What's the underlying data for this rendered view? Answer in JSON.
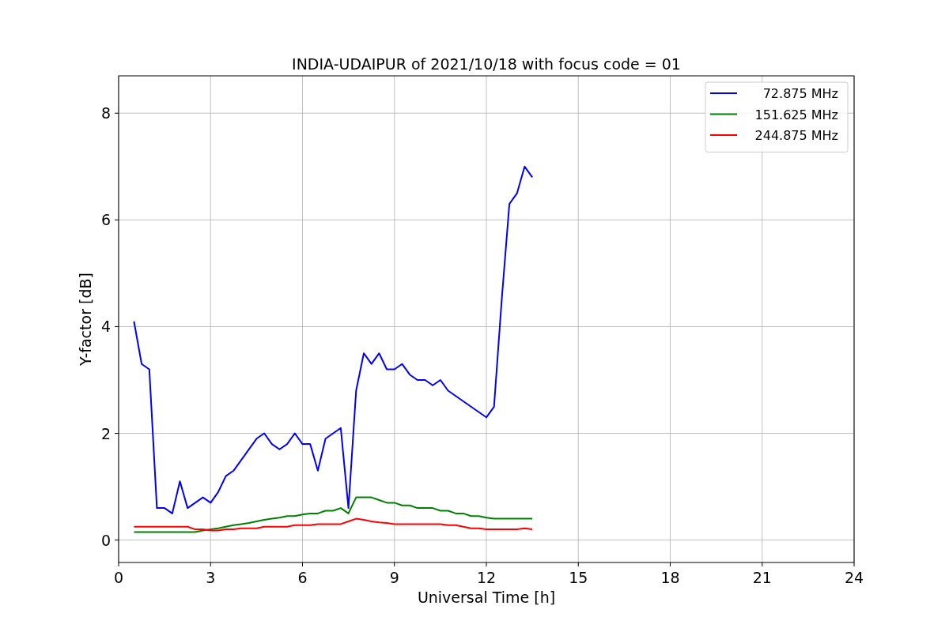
{
  "chart_data": {
    "type": "line",
    "title": "INDIA-UDAIPUR of 2021/10/18 with focus code = 01",
    "xlabel": "Universal Time [h]",
    "ylabel": "Y-factor [dB]",
    "x": [
      0.5,
      0.75,
      1,
      1.25,
      1.5,
      1.75,
      2,
      2.25,
      2.5,
      2.75,
      3,
      3.25,
      3.5,
      3.75,
      4,
      4.25,
      4.5,
      4.75,
      5,
      5.25,
      5.5,
      5.75,
      6,
      6.25,
      6.5,
      6.75,
      7,
      7.25,
      7.5,
      7.75,
      8,
      8.25,
      8.5,
      8.75,
      9,
      9.25,
      9.5,
      9.75,
      10,
      10.25,
      10.5,
      10.75,
      11,
      11.25,
      11.5,
      11.75,
      12,
      12.25,
      12.5,
      12.75,
      13,
      13.25,
      13.5
    ],
    "series": [
      {
        "name": "72.875 MHz",
        "color": "#0000ff",
        "values": [
          4.1,
          3.3,
          3.2,
          0.6,
          0.6,
          0.5,
          1.1,
          0.6,
          0.7,
          0.8,
          0.7,
          0.9,
          1.2,
          1.3,
          1.5,
          1.7,
          1.9,
          2.0,
          1.8,
          1.7,
          1.8,
          2.0,
          1.8,
          1.8,
          1.3,
          1.9,
          2.0,
          2.1,
          0.6,
          2.8,
          3.5,
          3.3,
          3.5,
          3.2,
          3.2,
          3.3,
          3.1,
          3.0,
          3.0,
          2.9,
          3.0,
          2.8,
          2.7,
          2.6,
          2.5,
          2.4,
          2.3,
          2.5,
          4.5,
          6.3,
          6.5,
          7.0,
          6.8
        ]
      },
      {
        "name": "151.625 MHz",
        "color": "#008000",
        "values": [
          0.15,
          0.15,
          0.15,
          0.15,
          0.15,
          0.15,
          0.15,
          0.15,
          0.15,
          0.18,
          0.2,
          0.22,
          0.25,
          0.28,
          0.3,
          0.32,
          0.35,
          0.38,
          0.4,
          0.42,
          0.45,
          0.45,
          0.48,
          0.5,
          0.5,
          0.55,
          0.55,
          0.6,
          0.5,
          0.8,
          0.8,
          0.8,
          0.75,
          0.7,
          0.7,
          0.65,
          0.65,
          0.6,
          0.6,
          0.6,
          0.55,
          0.55,
          0.5,
          0.5,
          0.45,
          0.45,
          0.42,
          0.4,
          0.4,
          0.4,
          0.4,
          0.4,
          0.4
        ]
      },
      {
        "name": "244.875 MHz",
        "color": "#ff0000",
        "values": [
          0.25,
          0.25,
          0.25,
          0.25,
          0.25,
          0.25,
          0.25,
          0.25,
          0.2,
          0.2,
          0.18,
          0.18,
          0.2,
          0.2,
          0.22,
          0.22,
          0.22,
          0.25,
          0.25,
          0.25,
          0.25,
          0.28,
          0.28,
          0.28,
          0.3,
          0.3,
          0.3,
          0.3,
          0.35,
          0.4,
          0.38,
          0.35,
          0.33,
          0.32,
          0.3,
          0.3,
          0.3,
          0.3,
          0.3,
          0.3,
          0.3,
          0.28,
          0.28,
          0.25,
          0.22,
          0.22,
          0.2,
          0.2,
          0.2,
          0.2,
          0.2,
          0.22,
          0.2
        ]
      }
    ],
    "xlim": [
      0,
      24
    ],
    "ylim": [
      -0.42,
      8.7
    ],
    "xticks": [
      0,
      3,
      6,
      9,
      12,
      15,
      18,
      21,
      24
    ],
    "yticks": [
      0,
      2,
      4,
      6,
      8
    ],
    "grid": true,
    "legend": true
  }
}
